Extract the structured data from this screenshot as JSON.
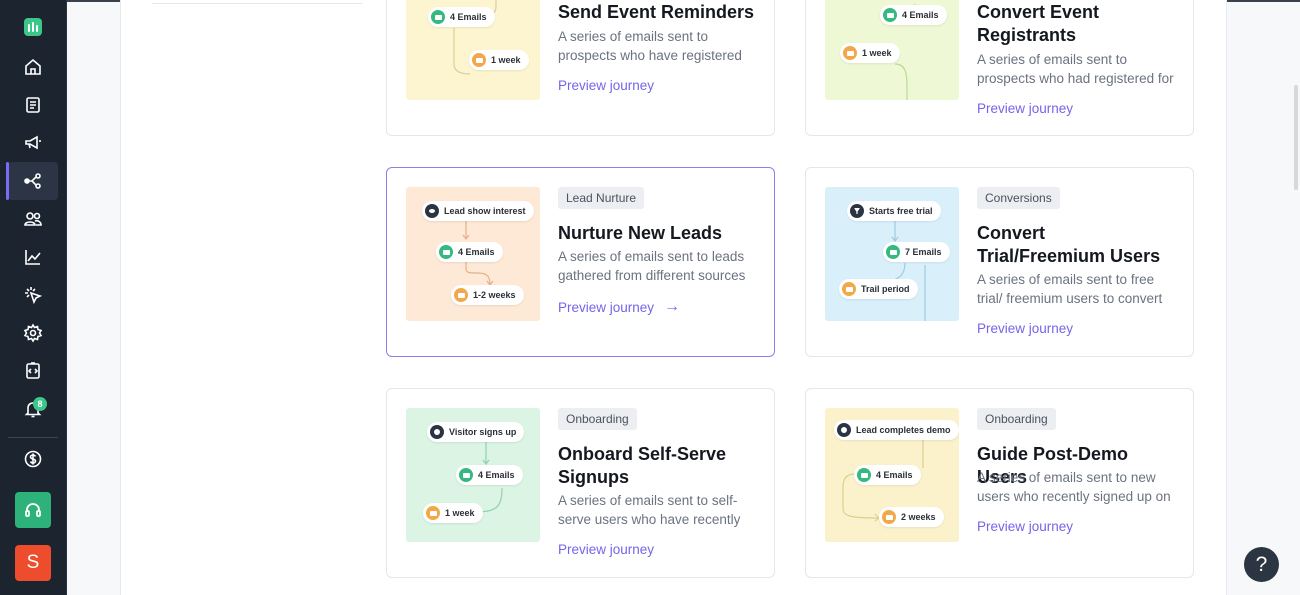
{
  "sidebar": {
    "items": [
      {
        "name": "home",
        "icon": "home-icon"
      },
      {
        "name": "content",
        "icon": "document-icon"
      },
      {
        "name": "campaigns",
        "icon": "megaphone-icon"
      },
      {
        "name": "journeys",
        "icon": "share-icon",
        "active": true
      },
      {
        "name": "audience",
        "icon": "users-icon"
      },
      {
        "name": "analytics",
        "icon": "chart-icon"
      },
      {
        "name": "tracking",
        "icon": "cursor-click-icon"
      },
      {
        "name": "settings",
        "icon": "gear-icon"
      },
      {
        "name": "integrations",
        "icon": "code-icon"
      },
      {
        "name": "notifications",
        "icon": "bell-icon"
      },
      {
        "name": "billing",
        "icon": "dollar-icon"
      }
    ],
    "notification_count": "8",
    "avatar_letter": "S"
  },
  "cards": [
    {
      "title": "Send Event Reminders",
      "description": "A series of emails sent to prospects who have registered",
      "preview": "Preview journey",
      "steps": [
        "4 Emails",
        "1 week"
      ]
    },
    {
      "title": "Convert Event Registrants",
      "description": "A series of emails sent to prospects who had registered for",
      "preview": "Preview journey",
      "steps": [
        "4 Emails",
        "1 week"
      ]
    },
    {
      "tag": "Lead Nurture",
      "title": "Nurture New Leads",
      "description": "A series of emails sent to leads gathered from different sources",
      "preview": "Preview journey",
      "preview_arrow": "→",
      "steps": [
        "Lead show interest",
        "4 Emails",
        "1-2 weeks"
      ]
    },
    {
      "tag": "Conversions",
      "title": "Convert Trial/Freemium Users",
      "description": "A series of emails sent to free trial/ freemium users to convert",
      "preview": "Preview journey",
      "steps": [
        "Starts free trial",
        "7 Emails",
        "Trail period"
      ]
    },
    {
      "tag": "Onboarding",
      "title": "Onboard Self-Serve Signups",
      "description": "A series of emails sent to self-serve users who have recently",
      "preview": "Preview journey",
      "steps": [
        "Visitor signs up",
        "4 Emails",
        "1 week"
      ]
    },
    {
      "tag": "Onboarding",
      "title": "Guide Post-Demo Users",
      "description": "A series of emails sent to new users who recently signed up on",
      "preview": "Preview journey",
      "steps": [
        "Lead completes demo",
        "4 Emails",
        "2 weeks"
      ]
    }
  ],
  "help_label": "?",
  "colors": {
    "accent": "#7565e8",
    "sidebar_bg": "#1c2430",
    "email_green": "#35b97f",
    "wait_orange": "#f2a84a"
  }
}
